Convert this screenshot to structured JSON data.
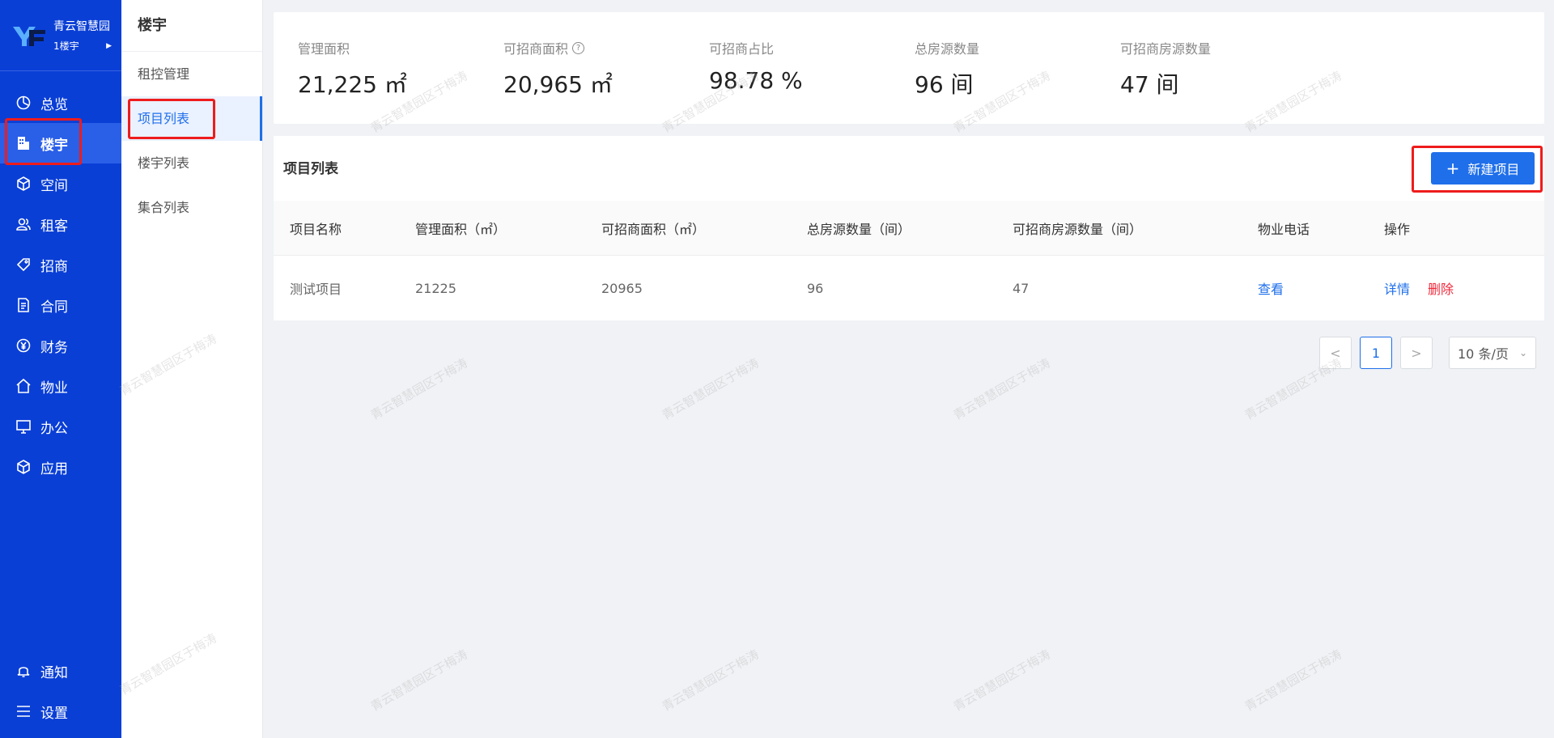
{
  "brand": {
    "name": "青云智慧园",
    "sub": "1楼宇"
  },
  "nav": {
    "items": [
      {
        "label": "总览",
        "icon": "pie-chart-icon"
      },
      {
        "label": "楼宇",
        "icon": "building-icon"
      },
      {
        "label": "空间",
        "icon": "cube-icon"
      },
      {
        "label": "租客",
        "icon": "users-icon"
      },
      {
        "label": "招商",
        "icon": "tag-icon"
      },
      {
        "label": "合同",
        "icon": "document-icon"
      },
      {
        "label": "财务",
        "icon": "yen-icon"
      },
      {
        "label": "物业",
        "icon": "home-icon"
      },
      {
        "label": "办公",
        "icon": "monitor-icon"
      },
      {
        "label": "应用",
        "icon": "box-icon"
      }
    ],
    "bottom": [
      {
        "label": "通知",
        "icon": "bell-icon"
      },
      {
        "label": "设置",
        "icon": "menu-icon"
      }
    ],
    "active": "楼宇"
  },
  "submenu": {
    "title": "楼宇",
    "items": [
      "租控管理",
      "项目列表",
      "楼宇列表",
      "集合列表"
    ],
    "active": "项目列表"
  },
  "stats": [
    {
      "label": "管理面积",
      "value": "21,225 ㎡"
    },
    {
      "label": "可招商面积",
      "value": "20,965 ㎡",
      "help": "?"
    },
    {
      "label": "可招商占比",
      "value": "98.78 %"
    },
    {
      "label": "总房源数量",
      "value": "96 间"
    },
    {
      "label": "可招商房源数量",
      "value": "47 间"
    }
  ],
  "list": {
    "title": "项目列表",
    "new_button": "新建项目",
    "columns": [
      "项目名称",
      "管理面积（㎡）",
      "可招商面积（㎡）",
      "总房源数量（间）",
      "可招商房源数量（间）",
      "物业电话",
      "操作"
    ],
    "rows": [
      {
        "name": "测试项目",
        "manage_area": "21225",
        "lease_area": "20965",
        "total_rooms": "96",
        "lease_rooms": "47",
        "phone": "查看",
        "detail": "详情",
        "delete": "删除"
      }
    ]
  },
  "pagination": {
    "prev": "<",
    "current": "1",
    "next": ">",
    "page_size": "10 条/页"
  },
  "watermark": "青云智慧园区于梅涛",
  "colors": {
    "sidebar": "#0a3fd6",
    "primary": "#1f6fea",
    "danger": "#ee2a3b",
    "highlight": "#ee1c1c"
  }
}
